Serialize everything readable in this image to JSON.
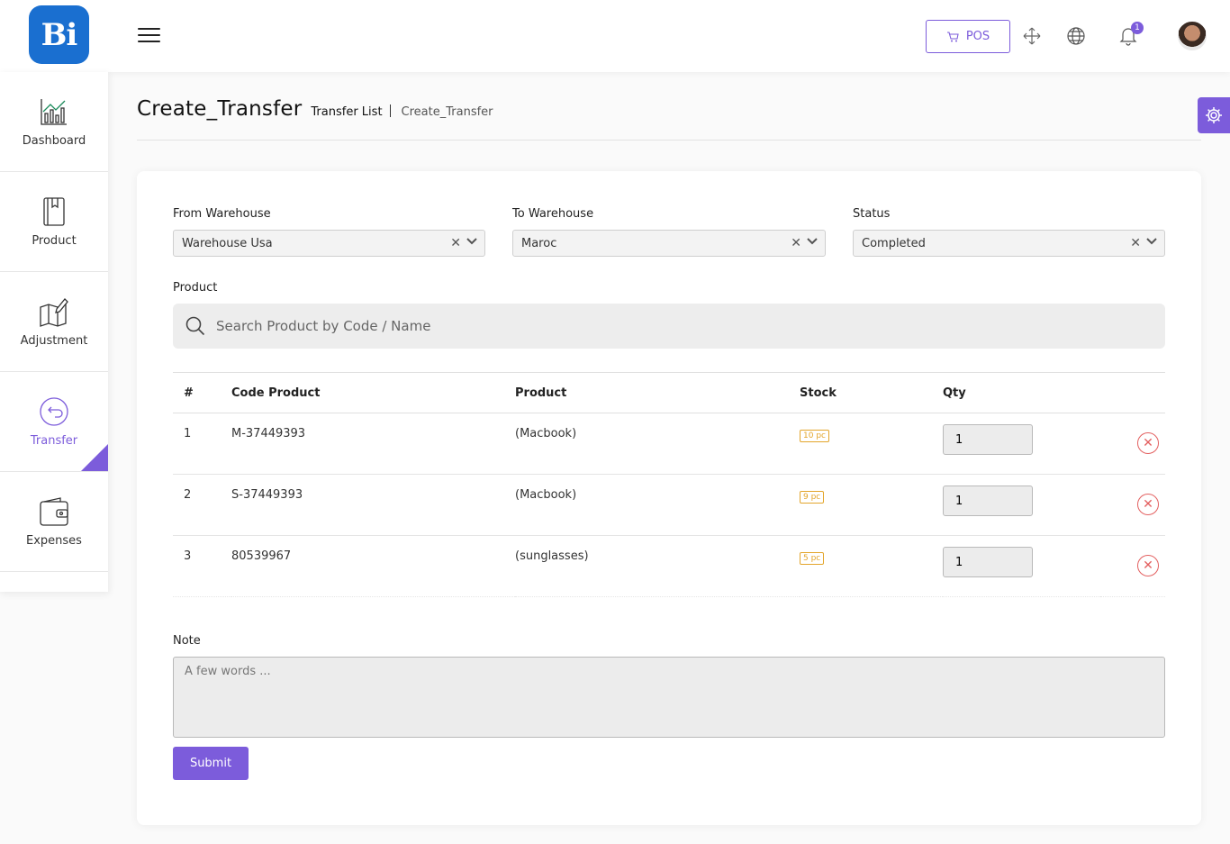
{
  "app": {
    "logo_text": "Bi",
    "pos_label": "POS",
    "notification_count": "1",
    "accent_color": "#7c5cdb"
  },
  "sidebar": {
    "items": [
      {
        "label": "Dashboard",
        "icon": "chart-icon"
      },
      {
        "label": "Product",
        "icon": "book-icon"
      },
      {
        "label": "Adjustment",
        "icon": "map-edit-icon"
      },
      {
        "label": "Transfer",
        "icon": "transfer-icon",
        "active": true
      },
      {
        "label": "Expenses",
        "icon": "wallet-icon"
      }
    ]
  },
  "header": {
    "title": "Create_Transfer",
    "breadcrumb_parent": "Transfer List",
    "breadcrumb_current": "Create_Transfer"
  },
  "form": {
    "from_warehouse_label": "From Warehouse",
    "from_warehouse_value": "Warehouse Usa",
    "to_warehouse_label": "To Warehouse",
    "to_warehouse_value": "Maroc",
    "status_label": "Status",
    "status_value": "Completed",
    "product_label": "Product",
    "search_placeholder": "Search Product by Code / Name",
    "note_label": "Note",
    "note_placeholder": "A few words ...",
    "submit_label": "Submit"
  },
  "table": {
    "headers": [
      "#",
      "Code Product",
      "Product",
      "Stock",
      "Qty"
    ],
    "rows": [
      {
        "num": "1",
        "code": "M-37449393",
        "product": "(Macbook)",
        "stock": "10 pc",
        "qty": "1"
      },
      {
        "num": "2",
        "code": "S-37449393",
        "product": "(Macbook)",
        "stock": "9 pc",
        "qty": "1"
      },
      {
        "num": "3",
        "code": "80539967",
        "product": "(sunglasses)",
        "stock": "5 pc",
        "qty": "1"
      }
    ]
  }
}
